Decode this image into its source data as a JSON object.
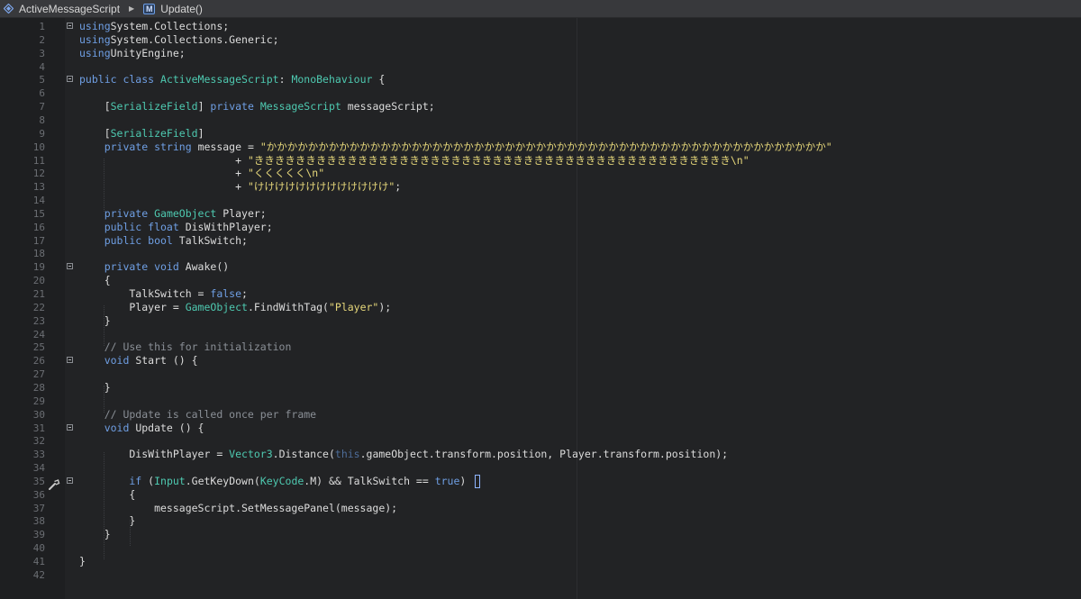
{
  "breadcrumb": {
    "class_label": "ActiveMessageScript",
    "method_badge": "M",
    "method_label": "Update()"
  },
  "colors": {
    "keyword": "#6f9fe4",
    "type": "#4ec9b0",
    "string": "#e6d77a",
    "comment": "#8a8f96",
    "plain": "#dcdcdc"
  },
  "lines": [
    {
      "n": "1",
      "fold": true,
      "segs": [
        [
          "kw",
          "using"
        ],
        [
          "",
          "System.Collections;"
        ]
      ]
    },
    {
      "n": "2",
      "segs": [
        [
          "kw",
          "using"
        ],
        [
          "",
          "System.Collections.Generic;"
        ]
      ]
    },
    {
      "n": "3",
      "segs": [
        [
          "kw",
          "using"
        ],
        [
          "",
          "UnityEngine;"
        ]
      ]
    },
    {
      "n": "4",
      "segs": []
    },
    {
      "n": "5",
      "fold": true,
      "segs": [
        [
          "kw",
          "public class "
        ],
        [
          "ty",
          "ActiveMessageScript"
        ],
        [
          "",
          ": "
        ],
        [
          "ty",
          "MonoBehaviour"
        ],
        [
          "",
          " {"
        ]
      ]
    },
    {
      "n": "6",
      "segs": []
    },
    {
      "n": "7",
      "segs": [
        [
          "",
          "    ["
        ],
        [
          "ty",
          "SerializeField"
        ],
        [
          "",
          "] "
        ],
        [
          "kw",
          "private "
        ],
        [
          "ty",
          "MessageScript"
        ],
        [
          "",
          " messageScript;"
        ]
      ]
    },
    {
      "n": "8",
      "segs": []
    },
    {
      "n": "9",
      "segs": [
        [
          "",
          "    ["
        ],
        [
          "ty",
          "SerializeField"
        ],
        [
          "",
          "]"
        ]
      ]
    },
    {
      "n": "10",
      "segs": [
        [
          "kw",
          "    private string "
        ],
        [
          "",
          "message = "
        ],
        [
          "str",
          "\"かかかかかかかかかかかかかかかかかかかかかかかかかかかかかかかかかかかかかかかかかかかかかかかかかかかかかか\""
        ]
      ]
    },
    {
      "n": "11",
      "segs": [
        [
          "",
          "                         + "
        ],
        [
          "str",
          "\"きききききききききききききききききききききききききききききききききききききききききききききき\\n\""
        ]
      ]
    },
    {
      "n": "12",
      "segs": [
        [
          "",
          "                         + "
        ],
        [
          "str",
          "\"くくくくく\\n\""
        ]
      ]
    },
    {
      "n": "13",
      "segs": [
        [
          "",
          "                         + "
        ],
        [
          "str",
          "\"けけけけけけけけけけけけけ\""
        ],
        [
          "",
          ";"
        ]
      ]
    },
    {
      "n": "14",
      "segs": []
    },
    {
      "n": "15",
      "segs": [
        [
          "kw",
          "    private "
        ],
        [
          "ty",
          "GameObject"
        ],
        [
          "",
          " Player;"
        ]
      ]
    },
    {
      "n": "16",
      "segs": [
        [
          "kw",
          "    public float "
        ],
        [
          "",
          "DisWithPlayer;"
        ]
      ]
    },
    {
      "n": "17",
      "segs": [
        [
          "kw",
          "    public bool "
        ],
        [
          "",
          "TalkSwitch;"
        ]
      ]
    },
    {
      "n": "18",
      "segs": []
    },
    {
      "n": "19",
      "fold": true,
      "segs": [
        [
          "kw",
          "    private void "
        ],
        [
          "",
          "Awake()"
        ]
      ]
    },
    {
      "n": "20",
      "segs": [
        [
          "",
          "    {"
        ]
      ]
    },
    {
      "n": "21",
      "segs": [
        [
          "",
          "        TalkSwitch = "
        ],
        [
          "kw",
          "false"
        ],
        [
          "",
          ";"
        ]
      ]
    },
    {
      "n": "22",
      "segs": [
        [
          "",
          "        Player = "
        ],
        [
          "ty",
          "GameObject"
        ],
        [
          "",
          ".FindWithTag("
        ],
        [
          "str",
          "\"Player\""
        ],
        [
          "",
          ");"
        ]
      ]
    },
    {
      "n": "23",
      "segs": [
        [
          "",
          "    }"
        ]
      ]
    },
    {
      "n": "24",
      "segs": []
    },
    {
      "n": "25",
      "segs": [
        [
          "cm",
          "    // Use this for initialization"
        ]
      ]
    },
    {
      "n": "26",
      "fold": true,
      "segs": [
        [
          "kw",
          "    void "
        ],
        [
          "",
          "Start () {"
        ]
      ]
    },
    {
      "n": "27",
      "segs": []
    },
    {
      "n": "28",
      "segs": [
        [
          "",
          "    }"
        ]
      ]
    },
    {
      "n": "29",
      "segs": []
    },
    {
      "n": "30",
      "segs": [
        [
          "cm",
          "    // Update is called once per frame"
        ]
      ]
    },
    {
      "n": "31",
      "fold": true,
      "segs": [
        [
          "kw",
          "    void "
        ],
        [
          "",
          "Update () {"
        ]
      ]
    },
    {
      "n": "32",
      "segs": []
    },
    {
      "n": "33",
      "segs": [
        [
          "",
          "        DisWithPlayer = "
        ],
        [
          "ty",
          "Vector3"
        ],
        [
          "",
          ".Distance("
        ],
        [
          "dim",
          "this"
        ],
        [
          "",
          ".gameObject.transform.position, Player.transform.position);"
        ]
      ]
    },
    {
      "n": "34",
      "segs": []
    },
    {
      "n": "35",
      "fold": true,
      "segs": [
        [
          "kw",
          "        if "
        ],
        [
          "",
          "("
        ],
        [
          "ty",
          "Input"
        ],
        [
          "",
          ".GetKeyDown("
        ],
        [
          "ty",
          "KeyCode"
        ],
        [
          "",
          ".M) && TalkSwitch == "
        ],
        [
          "kw",
          "true"
        ],
        [
          "",
          ")"
        ]
      ]
    },
    {
      "n": "36",
      "segs": [
        [
          "",
          "        {"
        ]
      ]
    },
    {
      "n": "37",
      "segs": [
        [
          "",
          "            messageScript.SetMessagePanel(message);"
        ]
      ]
    },
    {
      "n": "38",
      "segs": [
        [
          "",
          "        }"
        ]
      ]
    },
    {
      "n": "39",
      "segs": [
        [
          "",
          "    }"
        ]
      ]
    },
    {
      "n": "40",
      "segs": []
    },
    {
      "n": "41",
      "segs": [
        [
          "",
          "}"
        ]
      ]
    },
    {
      "n": "42",
      "segs": []
    }
  ]
}
